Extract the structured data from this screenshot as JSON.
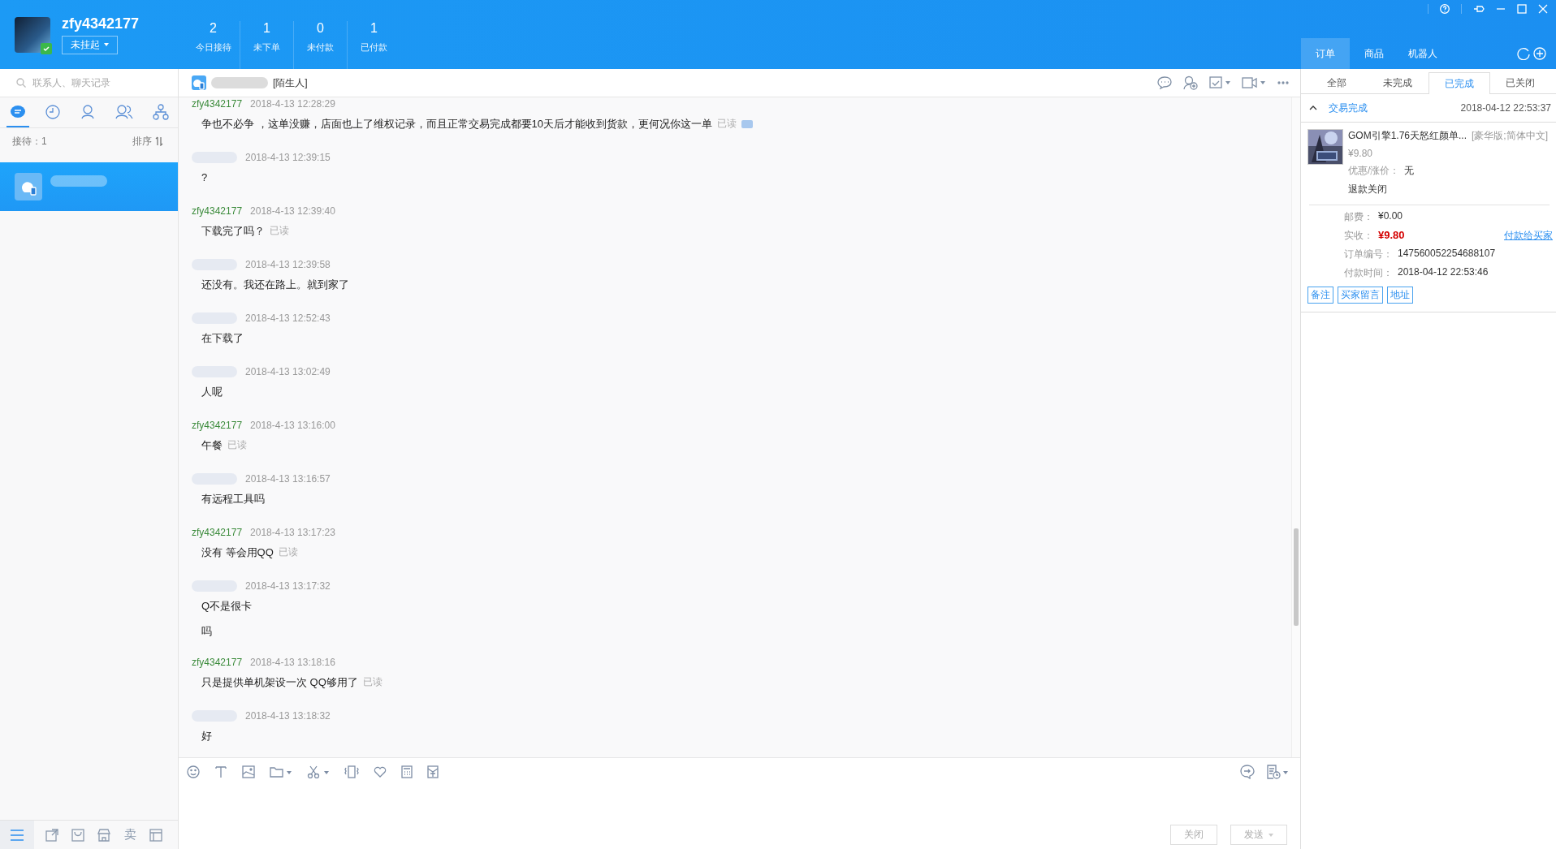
{
  "account": {
    "name": "zfy4342177",
    "status": "未挂起"
  },
  "stats": [
    {
      "value": "2",
      "label": "今日接待"
    },
    {
      "value": "1",
      "label": "未下单"
    },
    {
      "value": "0",
      "label": "未付款"
    },
    {
      "value": "1",
      "label": "已付款"
    }
  ],
  "side_tabs": [
    {
      "label": "订单",
      "selected": true
    },
    {
      "label": "商品",
      "selected": false
    },
    {
      "label": "机器人",
      "selected": false
    }
  ],
  "sidebar": {
    "search": {
      "placeholder": "联系人、聊天记录"
    },
    "icon_tabs": [
      {
        "kind": "chat",
        "selected": true
      },
      {
        "kind": "clock",
        "selected": false
      },
      {
        "kind": "person",
        "selected": false
      },
      {
        "kind": "people",
        "selected": false
      },
      {
        "kind": "org",
        "selected": false
      }
    ],
    "reception": "接待：1",
    "sort": "排序",
    "contacts": [
      {
        "selected": true
      }
    ],
    "bottom_tools": [
      {
        "kind": "menu",
        "selected": true
      },
      {
        "kind": "transfer",
        "selected": false
      },
      {
        "kind": "bag",
        "selected": false
      },
      {
        "kind": "shop",
        "selected": false
      },
      {
        "kind": "text",
        "label": "卖",
        "selected": false
      },
      {
        "kind": "layout",
        "selected": false
      }
    ]
  },
  "chat": {
    "contact_tag": "[陌生人]",
    "messages": [
      {
        "kind": "self",
        "sender": "zfy4342177",
        "time": "2018-4-13 12:28:29",
        "lines": [
          "争也不必争 ，这单没赚，店面也上了维权记录，而且正常交易完成都要10天后才能收到货款，更何况你这一单"
        ],
        "receipt": "已读",
        "more": true
      },
      {
        "kind": "other",
        "time": "2018-4-13 12:39:15",
        "lines": [
          "?"
        ]
      },
      {
        "kind": "self",
        "sender": "zfy4342177",
        "time": "2018-4-13 12:39:40",
        "lines": [
          "下载完了吗？"
        ],
        "receipt": "已读"
      },
      {
        "kind": "other",
        "time": "2018-4-13 12:39:58",
        "lines": [
          "还没有。我还在路上。就到家了"
        ]
      },
      {
        "kind": "other",
        "time": "2018-4-13 12:52:43",
        "lines": [
          "在下载了"
        ]
      },
      {
        "kind": "other",
        "time": "2018-4-13 13:02:49",
        "lines": [
          "人呢"
        ]
      },
      {
        "kind": "self",
        "sender": "zfy4342177",
        "time": "2018-4-13 13:16:00",
        "lines": [
          "午餐"
        ],
        "receipt": "已读"
      },
      {
        "kind": "other",
        "time": "2018-4-13 13:16:57",
        "lines": [
          "有远程工具吗"
        ]
      },
      {
        "kind": "self",
        "sender": "zfy4342177",
        "time": "2018-4-13 13:17:23",
        "lines": [
          "没有 等会用QQ"
        ],
        "receipt": "已读"
      },
      {
        "kind": "other",
        "time": "2018-4-13 13:17:32",
        "lines": [
          "Q不是很卡",
          "吗"
        ]
      },
      {
        "kind": "self",
        "sender": "zfy4342177",
        "time": "2018-4-13 13:18:16",
        "lines": [
          "只是提供单机架设一次 QQ够用了"
        ],
        "receipt": "已读"
      },
      {
        "kind": "other",
        "time": "2018-4-13 13:18:32",
        "lines": [
          "好"
        ]
      }
    ],
    "buttons": [
      {
        "label": "关闭",
        "kind": "plain"
      },
      {
        "label": "发送",
        "kind": "split"
      }
    ]
  },
  "orders": {
    "tabs": [
      {
        "label": "全部",
        "selected": false
      },
      {
        "label": "未完成",
        "selected": false
      },
      {
        "label": "已完成",
        "selected": true
      },
      {
        "label": "已关闭",
        "selected": false
      }
    ],
    "order": {
      "status": "交易完成",
      "expanded": true,
      "time": "2018-04-12 22:53:37",
      "item_title": "GOM引擎1.76天怒红颜单...",
      "item_sku": "[豪华版;简体中文]",
      "item_price": "¥9.80",
      "discount_label": "优惠/涨价：",
      "discount_value": "无",
      "refund": "退款关闭",
      "fields": [
        {
          "label": "邮费：",
          "value": "¥0.00",
          "kind": "plain"
        },
        {
          "label": "实收：",
          "value": "¥9.80",
          "kind": "amount",
          "link": "付款给买家"
        },
        {
          "label": "订单编号：",
          "value": "147560052254688107",
          "kind": "plain"
        },
        {
          "label": "付款时间：",
          "value": "2018-04-12 22:53:46",
          "kind": "plain"
        }
      ],
      "tags": [
        "备注",
        "买家留言",
        "地址"
      ]
    }
  }
}
